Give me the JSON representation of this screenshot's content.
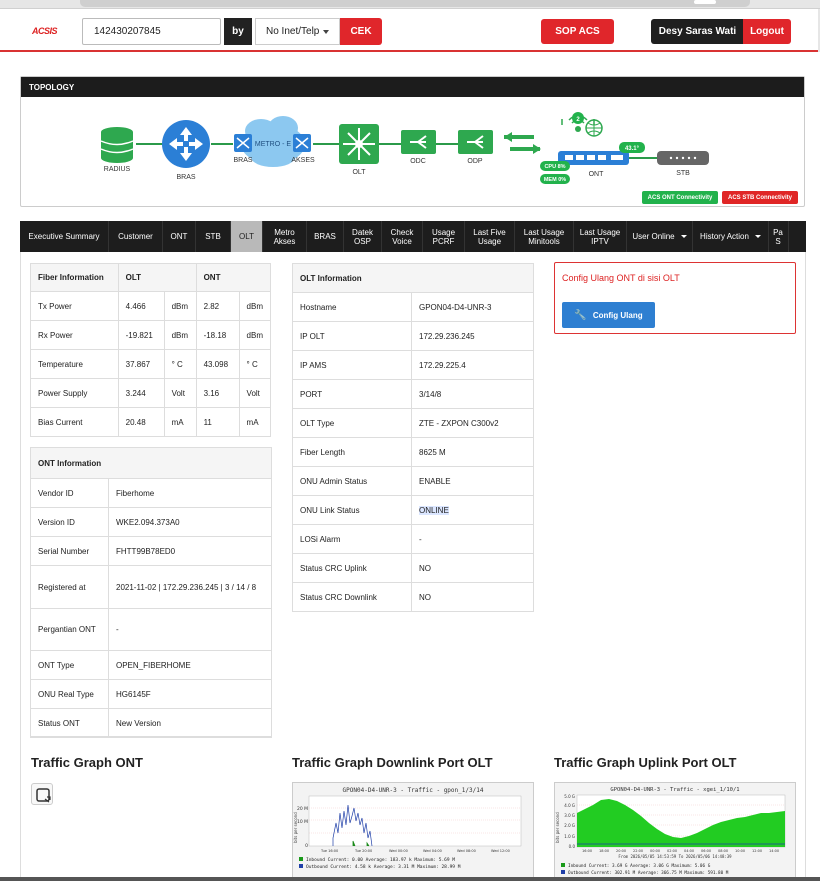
{
  "header": {
    "logo": "ACSIS",
    "search_value": "142430207845",
    "by_label": "by",
    "search_type": "No Inet/Telp",
    "cek_label": "CEK",
    "sop_label": "SOP ACS",
    "user_name": "Desy Saras Wati",
    "logout_label": "Logout"
  },
  "topology": {
    "title": "TOPOLOGY",
    "nodes": {
      "radius": "RADIUS",
      "bras": "BRAS",
      "bras2": "BRAS",
      "metro": "METRO - E",
      "akses": "AKSES",
      "olt": "OLT",
      "odc": "ODC",
      "odp": "ODP",
      "ont": "ONT",
      "stb": "STB"
    },
    "ont_badges": {
      "count": "2",
      "cpu": "CPU 8%",
      "mem": "MEM 0%",
      "temp": "43.1°"
    },
    "acs_ont": "ACS ONT Connectivity",
    "acs_stb": "ACS STB Connectivity"
  },
  "tabs": [
    {
      "label": "Executive Summary"
    },
    {
      "label": "Customer"
    },
    {
      "label": "ONT"
    },
    {
      "label": "STB"
    },
    {
      "label": "OLT"
    },
    {
      "label": "Metro Akses"
    },
    {
      "label": "BRAS"
    },
    {
      "label": "Datek OSP"
    },
    {
      "label": "Check Voice"
    },
    {
      "label": "Usage PCRF"
    },
    {
      "label": "Last Five Usage"
    },
    {
      "label": "Last Usage Minitools"
    },
    {
      "label": "Last Usage IPTV"
    },
    {
      "label": "User Online"
    },
    {
      "label": "History Action"
    },
    {
      "label": "Pa S"
    }
  ],
  "fiber": {
    "headers": [
      "Fiber Information",
      "OLT",
      "ONT"
    ],
    "rows": [
      {
        "label": "Tx Power",
        "olt": "4.466",
        "olt_unit": "dBm",
        "ont": "2.82",
        "ont_unit": "dBm"
      },
      {
        "label": "Rx Power",
        "olt": "-19.821",
        "olt_unit": "dBm",
        "ont": "-18.18",
        "ont_unit": "dBm"
      },
      {
        "label": "Temperature",
        "olt": "37.867",
        "olt_unit": "° C",
        "ont": "43.098",
        "ont_unit": "° C"
      },
      {
        "label": "Power Supply",
        "olt": "3.244",
        "olt_unit": "Volt",
        "ont": "3.16",
        "ont_unit": "Volt"
      },
      {
        "label": "Bias Current",
        "olt": "20.48",
        "olt_unit": "mA",
        "ont": "11",
        "ont_unit": "mA"
      }
    ]
  },
  "ont_info": {
    "title": "ONT Information",
    "rows": [
      {
        "label": "Vendor ID",
        "value": "Fiberhome"
      },
      {
        "label": "Version ID",
        "value": "WKE2.094.373A0"
      },
      {
        "label": "Serial Number",
        "value": "FHTT99B78ED0"
      },
      {
        "label": "Registered at",
        "value": "2021-11-02 | 172.29.236.245 | 3 / 14 / 8"
      },
      {
        "label": "Pergantian ONT",
        "value": "-"
      },
      {
        "label": "ONT Type",
        "value": "OPEN_FIBERHOME"
      },
      {
        "label": "ONU Real Type",
        "value": "HG6145F"
      },
      {
        "label": "Status ONT",
        "value": "New Version"
      }
    ]
  },
  "olt_info": {
    "title": "OLT Information",
    "rows": [
      {
        "label": "Hostname",
        "value": "GPON04-D4-UNR-3"
      },
      {
        "label": "IP OLT",
        "value": "172.29.236.245"
      },
      {
        "label": "IP AMS",
        "value": "172.29.225.4"
      },
      {
        "label": "PORT",
        "value": "3/14/8"
      },
      {
        "label": "OLT Type",
        "value": "ZTE - ZXPON C300v2"
      },
      {
        "label": "Fiber Length",
        "value": "8625 M"
      },
      {
        "label": "ONU Admin Status",
        "value": "ENABLE"
      },
      {
        "label": "ONU Link Status",
        "value": "ONLINE"
      },
      {
        "label": "LOSi Alarm",
        "value": "-"
      },
      {
        "label": "Status CRC Uplink",
        "value": "NO"
      },
      {
        "label": "Status CRC Downlink",
        "value": "NO"
      }
    ]
  },
  "config": {
    "title": "Config Ulang ONT di sisi OLT",
    "button": "Config Ulang"
  },
  "traffic": {
    "ont_title": "Traffic Graph ONT",
    "downlink_title": "Traffic Graph Downlink Port OLT",
    "uplink_title": "Traffic Graph Uplink Port OLT",
    "downlink": {
      "graph_title": "GPON04-D4-UNR-3 - Traffic - gpon_1/3/14",
      "ylabel": "bits per second",
      "yticks": [
        "20 M",
        "10 M",
        "0"
      ],
      "xticks": [
        "Tue 16:00",
        "Tue 20:00",
        "Wed 00:00",
        "Wed 04:00",
        "Wed 08:00",
        "Wed 12:00"
      ],
      "inbound": "Inbound    Current:     0.00    Average:  183.97 k   Maximum:    5.69 M",
      "outbound": "Outbound   Current:    4.58 k   Average:    3.31 M   Maximum:   28.99 M"
    },
    "uplink": {
      "graph_title": "GPON04-D4-UNR-3 - Traffic - xgei_1/10/1",
      "ylabel": "bits per second",
      "yticks": [
        "5.0 G",
        "4.0 G",
        "3.0 G",
        "2.0 G",
        "1.0 G",
        "0.0"
      ],
      "xticks": [
        "16:00",
        "18:00",
        "20:00",
        "22:00",
        "00:00",
        "02:00",
        "04:00",
        "06:00",
        "08:00",
        "10:00",
        "12:00",
        "14:00"
      ],
      "range": "From 2026/05/05 14:53:59 To 2026/05/06 14:48:39",
      "inbound": "Inbound   Current:    3.69 G   Average:    3.06 G   Maximum:    5.06 G",
      "outbound": "Outbound  Current:  302.91 M   Average:  366.75 M   Maximum:  591.80 M"
    }
  },
  "colors": {
    "accent_red": "#e0262b",
    "green": "#22b24c",
    "blue": "#2e7fd1",
    "dark": "#1d1d1d"
  }
}
